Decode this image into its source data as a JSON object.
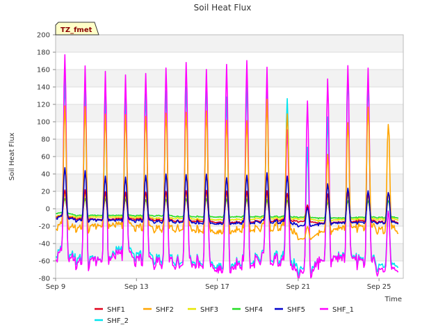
{
  "chart_data": {
    "type": "line",
    "title": "Soil Heat Flux",
    "xlabel": "Time",
    "ylabel": "Soil Heat Flux",
    "badge": "TZ_fmet",
    "x_range_days": [
      9,
      26.2
    ],
    "x_ticks": [
      {
        "day": 9,
        "label": "Sep 9"
      },
      {
        "day": 13,
        "label": "Sep 13"
      },
      {
        "day": 17,
        "label": "Sep 17"
      },
      {
        "day": 21,
        "label": "Sep 21"
      },
      {
        "day": 25,
        "label": "Sep 25"
      }
    ],
    "ylim": [
      -80,
      200
    ],
    "y_ticks": [
      -80,
      -60,
      -40,
      -20,
      0,
      20,
      40,
      60,
      80,
      100,
      120,
      140,
      160,
      180,
      200
    ],
    "grid": "horizontal bands",
    "legend_position": "bottom",
    "sampling": "daily maximum (midday peak) and minimum (night) values, days Sep 9 to Sep 25",
    "days": [
      9,
      10,
      11,
      12,
      13,
      14,
      15,
      16,
      17,
      18,
      19,
      20,
      21,
      22,
      23,
      24,
      25
    ],
    "series": [
      {
        "name": "SHF1",
        "color": "#e0001a",
        "peaks": [
          22,
          22,
          20,
          20,
          20,
          20,
          20,
          20,
          20,
          20,
          20,
          18,
          5,
          18,
          20,
          18,
          20
        ],
        "troughs": [
          -9,
          -12,
          -13,
          -12,
          -12,
          -13,
          -14,
          -14,
          -15,
          -15,
          -14,
          -13,
          -15,
          -17,
          -16,
          -14,
          -15
        ]
      },
      {
        "name": "SHF2",
        "color": "#ffa500",
        "peaks": [
          120,
          118,
          110,
          112,
          110,
          110,
          108,
          108,
          100,
          100,
          122,
          110,
          -20,
          65,
          103,
          122,
          102
        ],
        "troughs": [
          -20,
          -24,
          -22,
          -20,
          -22,
          -23,
          -23,
          -24,
          -24,
          -23,
          -22,
          -20,
          -35,
          -28,
          -24,
          -22,
          -24
        ]
      },
      {
        "name": "SHF3",
        "color": "#e6e600",
        "peaks": [
          18,
          18,
          17,
          17,
          17,
          17,
          17,
          17,
          17,
          17,
          16,
          15,
          3,
          12,
          16,
          15,
          16
        ],
        "troughs": [
          -8,
          -10,
          -10,
          -10,
          -10,
          -11,
          -11,
          -12,
          -12,
          -12,
          -11,
          -11,
          -12,
          -14,
          -13,
          -12,
          -12
        ]
      },
      {
        "name": "SHF4",
        "color": "#22dd22",
        "peaks": [
          12,
          12,
          12,
          12,
          11,
          11,
          11,
          11,
          11,
          11,
          10,
          10,
          2,
          8,
          10,
          10,
          10
        ],
        "troughs": [
          -5,
          -8,
          -8,
          -8,
          -8,
          -8,
          -9,
          -9,
          -9,
          -9,
          -9,
          -9,
          -10,
          -11,
          -11,
          -10,
          -10
        ]
      },
      {
        "name": "SHF5",
        "color": "#0000cc",
        "peaks": [
          48,
          44,
          38,
          38,
          40,
          40,
          38,
          38,
          35,
          38,
          40,
          38,
          2,
          30,
          25,
          22,
          20
        ],
        "troughs": [
          -10,
          -14,
          -14,
          -14,
          -14,
          -15,
          -15,
          -16,
          -16,
          -16,
          -15,
          -15,
          -20,
          -18,
          -17,
          -16,
          -16
        ]
      },
      {
        "name": "SHF_1",
        "color": "#ff00ff",
        "peaks": [
          180,
          165,
          160,
          160,
          162,
          162,
          163,
          153,
          163,
          168,
          157,
          92,
          130,
          155,
          172,
          170,
          0
        ],
        "troughs": [
          -53,
          -65,
          -63,
          -55,
          -60,
          -62,
          -63,
          -62,
          -65,
          -62,
          -58,
          -60,
          -78,
          -63,
          -60,
          -62,
          -70
        ]
      },
      {
        "name": "SHF_2",
        "color": "#00e5ee",
        "peaks": [
          152,
          138,
          132,
          133,
          138,
          136,
          136,
          136,
          126,
          140,
          145,
          128,
          75,
          110,
          162,
          155,
          0
        ],
        "troughs": [
          -50,
          -60,
          -62,
          -50,
          -55,
          -58,
          -60,
          -60,
          -62,
          -60,
          -55,
          -56,
          -72,
          -62,
          -58,
          -60,
          -65
        ]
      }
    ]
  }
}
